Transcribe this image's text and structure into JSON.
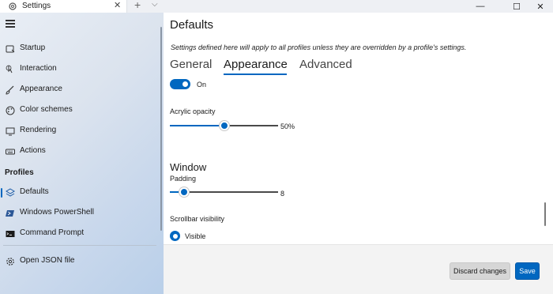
{
  "window": {
    "tab_title": "Settings",
    "tab_close": "✕",
    "new_tab": "+",
    "tab_dropdown": "⌵",
    "minimize": "—",
    "maximize": "☐",
    "close": "✕"
  },
  "sidebar": {
    "items": [
      {
        "label": "Startup",
        "icon": "startup-icon"
      },
      {
        "label": "Interaction",
        "icon": "interaction-icon"
      },
      {
        "label": "Appearance",
        "icon": "brush-icon"
      },
      {
        "label": "Color schemes",
        "icon": "palette-icon"
      },
      {
        "label": "Rendering",
        "icon": "monitor-icon"
      },
      {
        "label": "Actions",
        "icon": "keyboard-icon"
      }
    ],
    "profiles_heading": "Profiles",
    "profiles": [
      {
        "label": "Defaults",
        "icon": "layers-icon",
        "selected": true
      },
      {
        "label": "Windows PowerShell",
        "icon": "powershell-icon"
      },
      {
        "label": "Command Prompt",
        "icon": "cmd-icon"
      }
    ],
    "open_json": "Open JSON file"
  },
  "main": {
    "title": "Defaults",
    "description": "Settings defined here will apply to all profiles unless they are overridden by a profile's settings.",
    "tabs": [
      "General",
      "Appearance",
      "Advanced"
    ],
    "active_tab": "Appearance",
    "acrylic_toggle": {
      "state": "On",
      "checked": true
    },
    "acrylic_opacity": {
      "label": "Acrylic opacity",
      "value": "50%",
      "fraction": 0.5
    },
    "window_heading": "Window",
    "padding": {
      "label": "Padding",
      "value": "8",
      "fraction": 0.13
    },
    "scrollbar_visibility": {
      "label": "Scrollbar visibility",
      "selected_option": "Visible"
    }
  },
  "actions": {
    "discard": "Discard changes",
    "save": "Save"
  },
  "colors": {
    "accent": "#0067c0",
    "sidebar_bg": "#dbe3ee",
    "action_bar_bg": "#f3f3f3"
  }
}
